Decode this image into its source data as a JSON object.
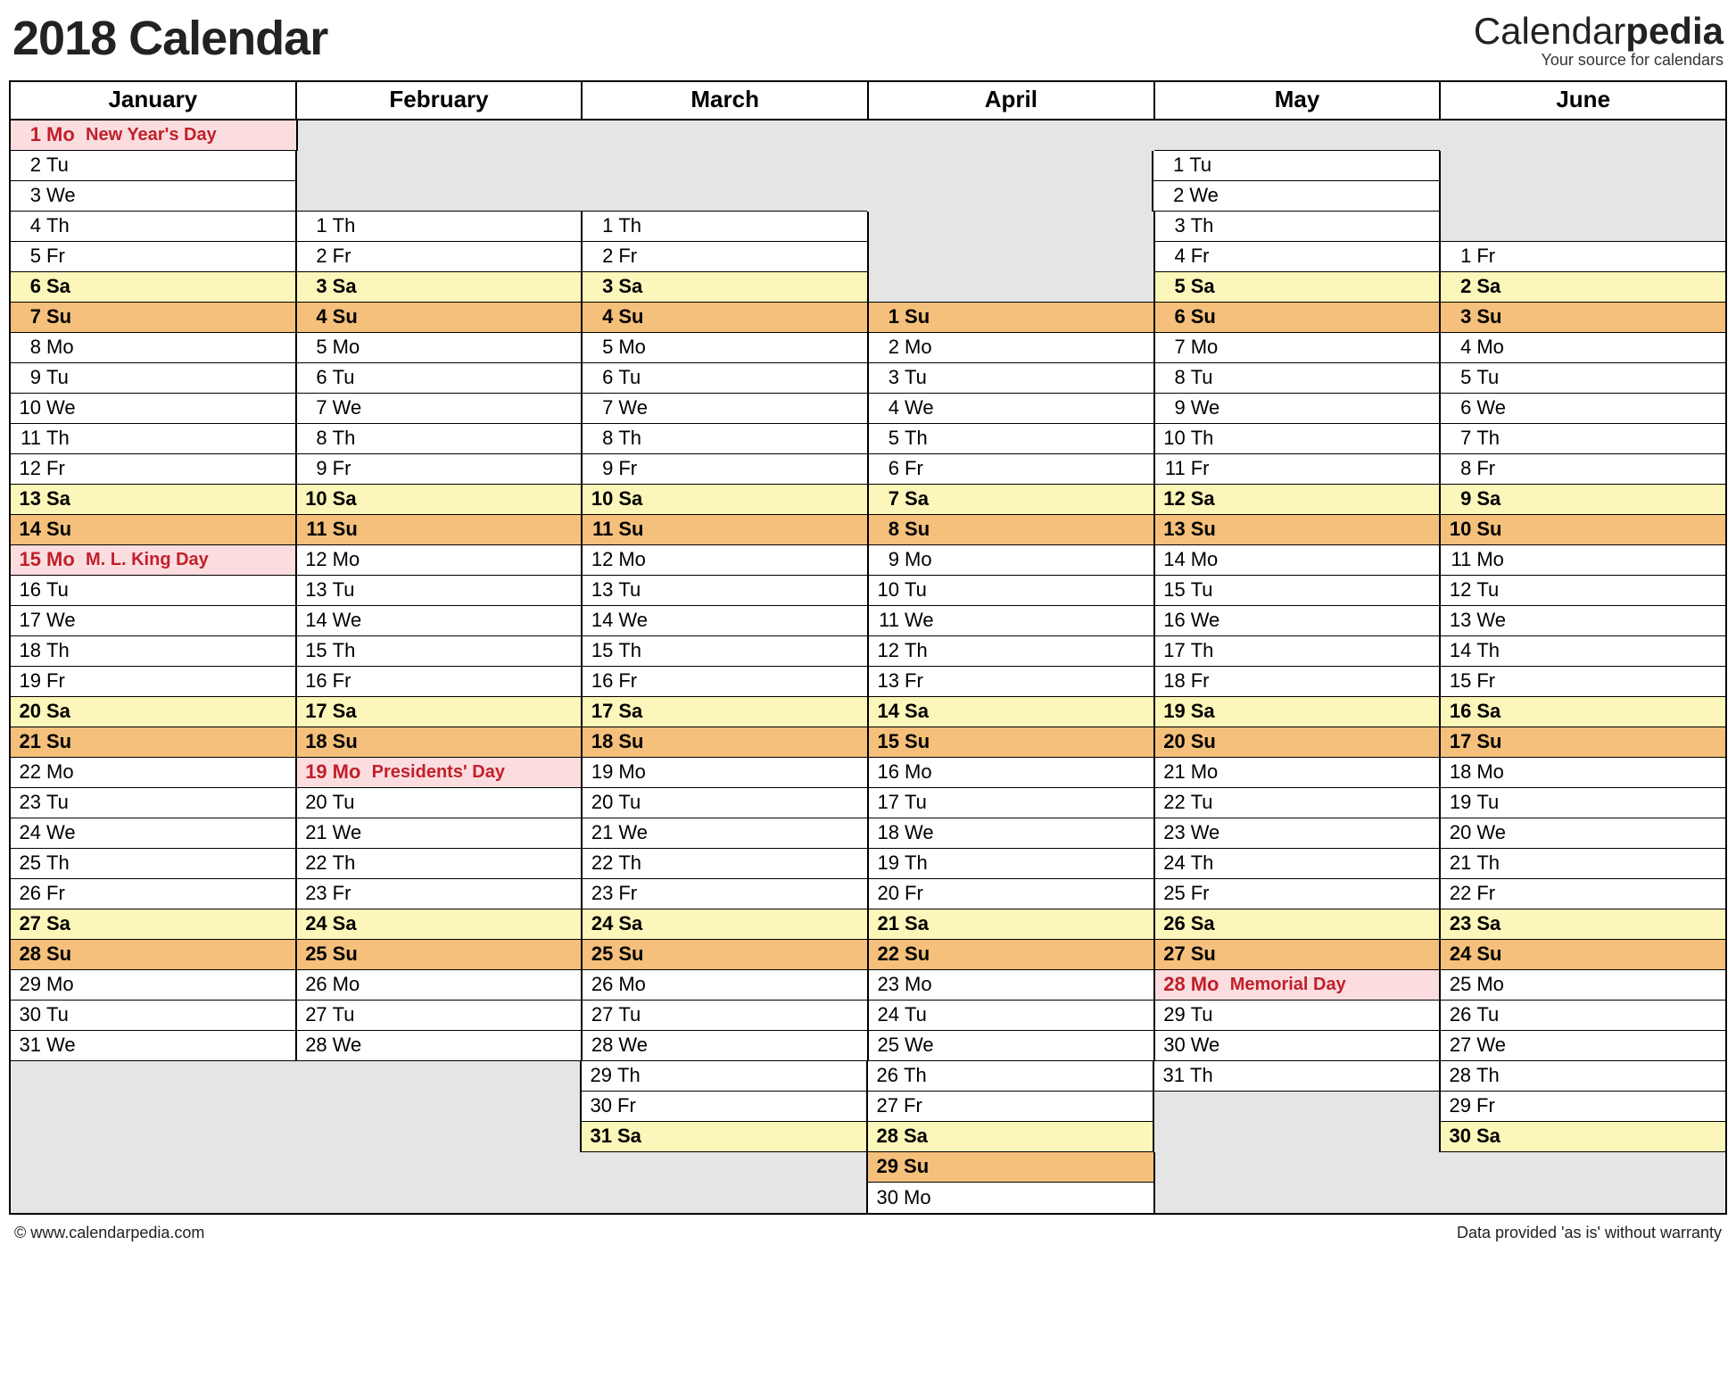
{
  "header": {
    "title": "2018 Calendar",
    "brand_main_a": "Calendar",
    "brand_main_b": "pedia",
    "brand_sub": "Your source for calendars"
  },
  "footer": {
    "left": "© www.calendarpedia.com",
    "right": "Data provided 'as is' without warranty"
  },
  "months": [
    "January",
    "February",
    "March",
    "April",
    "May",
    "June"
  ],
  "rows": [
    [
      {
        "n": 1,
        "d": "Mo",
        "e": "New Year's Day",
        "h": true
      },
      null,
      null,
      null,
      null,
      null
    ],
    [
      {
        "n": 2,
        "d": "Tu"
      },
      null,
      null,
      null,
      {
        "n": 1,
        "d": "Tu"
      },
      null
    ],
    [
      {
        "n": 3,
        "d": "We"
      },
      null,
      null,
      null,
      {
        "n": 2,
        "d": "We"
      },
      null
    ],
    [
      {
        "n": 4,
        "d": "Th"
      },
      {
        "n": 1,
        "d": "Th"
      },
      {
        "n": 1,
        "d": "Th"
      },
      null,
      {
        "n": 3,
        "d": "Th"
      },
      null
    ],
    [
      {
        "n": 5,
        "d": "Fr"
      },
      {
        "n": 2,
        "d": "Fr"
      },
      {
        "n": 2,
        "d": "Fr"
      },
      null,
      {
        "n": 4,
        "d": "Fr"
      },
      {
        "n": 1,
        "d": "Fr"
      }
    ],
    [
      {
        "n": 6,
        "d": "Sa"
      },
      {
        "n": 3,
        "d": "Sa"
      },
      {
        "n": 3,
        "d": "Sa"
      },
      null,
      {
        "n": 5,
        "d": "Sa"
      },
      {
        "n": 2,
        "d": "Sa"
      }
    ],
    [
      {
        "n": 7,
        "d": "Su"
      },
      {
        "n": 4,
        "d": "Su"
      },
      {
        "n": 4,
        "d": "Su"
      },
      {
        "n": 1,
        "d": "Su"
      },
      {
        "n": 6,
        "d": "Su"
      },
      {
        "n": 3,
        "d": "Su"
      }
    ],
    [
      {
        "n": 8,
        "d": "Mo"
      },
      {
        "n": 5,
        "d": "Mo"
      },
      {
        "n": 5,
        "d": "Mo"
      },
      {
        "n": 2,
        "d": "Mo"
      },
      {
        "n": 7,
        "d": "Mo"
      },
      {
        "n": 4,
        "d": "Mo"
      }
    ],
    [
      {
        "n": 9,
        "d": "Tu"
      },
      {
        "n": 6,
        "d": "Tu"
      },
      {
        "n": 6,
        "d": "Tu"
      },
      {
        "n": 3,
        "d": "Tu"
      },
      {
        "n": 8,
        "d": "Tu"
      },
      {
        "n": 5,
        "d": "Tu"
      }
    ],
    [
      {
        "n": 10,
        "d": "We"
      },
      {
        "n": 7,
        "d": "We"
      },
      {
        "n": 7,
        "d": "We"
      },
      {
        "n": 4,
        "d": "We"
      },
      {
        "n": 9,
        "d": "We"
      },
      {
        "n": 6,
        "d": "We"
      }
    ],
    [
      {
        "n": 11,
        "d": "Th"
      },
      {
        "n": 8,
        "d": "Th"
      },
      {
        "n": 8,
        "d": "Th"
      },
      {
        "n": 5,
        "d": "Th"
      },
      {
        "n": 10,
        "d": "Th"
      },
      {
        "n": 7,
        "d": "Th"
      }
    ],
    [
      {
        "n": 12,
        "d": "Fr"
      },
      {
        "n": 9,
        "d": "Fr"
      },
      {
        "n": 9,
        "d": "Fr"
      },
      {
        "n": 6,
        "d": "Fr"
      },
      {
        "n": 11,
        "d": "Fr"
      },
      {
        "n": 8,
        "d": "Fr"
      }
    ],
    [
      {
        "n": 13,
        "d": "Sa"
      },
      {
        "n": 10,
        "d": "Sa"
      },
      {
        "n": 10,
        "d": "Sa"
      },
      {
        "n": 7,
        "d": "Sa"
      },
      {
        "n": 12,
        "d": "Sa"
      },
      {
        "n": 9,
        "d": "Sa"
      }
    ],
    [
      {
        "n": 14,
        "d": "Su"
      },
      {
        "n": 11,
        "d": "Su"
      },
      {
        "n": 11,
        "d": "Su"
      },
      {
        "n": 8,
        "d": "Su"
      },
      {
        "n": 13,
        "d": "Su"
      },
      {
        "n": 10,
        "d": "Su"
      }
    ],
    [
      {
        "n": 15,
        "d": "Mo",
        "e": "M. L. King Day",
        "h": true
      },
      {
        "n": 12,
        "d": "Mo"
      },
      {
        "n": 12,
        "d": "Mo"
      },
      {
        "n": 9,
        "d": "Mo"
      },
      {
        "n": 14,
        "d": "Mo"
      },
      {
        "n": 11,
        "d": "Mo"
      }
    ],
    [
      {
        "n": 16,
        "d": "Tu"
      },
      {
        "n": 13,
        "d": "Tu"
      },
      {
        "n": 13,
        "d": "Tu"
      },
      {
        "n": 10,
        "d": "Tu"
      },
      {
        "n": 15,
        "d": "Tu"
      },
      {
        "n": 12,
        "d": "Tu"
      }
    ],
    [
      {
        "n": 17,
        "d": "We"
      },
      {
        "n": 14,
        "d": "We"
      },
      {
        "n": 14,
        "d": "We"
      },
      {
        "n": 11,
        "d": "We"
      },
      {
        "n": 16,
        "d": "We"
      },
      {
        "n": 13,
        "d": "We"
      }
    ],
    [
      {
        "n": 18,
        "d": "Th"
      },
      {
        "n": 15,
        "d": "Th"
      },
      {
        "n": 15,
        "d": "Th"
      },
      {
        "n": 12,
        "d": "Th"
      },
      {
        "n": 17,
        "d": "Th"
      },
      {
        "n": 14,
        "d": "Th"
      }
    ],
    [
      {
        "n": 19,
        "d": "Fr"
      },
      {
        "n": 16,
        "d": "Fr"
      },
      {
        "n": 16,
        "d": "Fr"
      },
      {
        "n": 13,
        "d": "Fr"
      },
      {
        "n": 18,
        "d": "Fr"
      },
      {
        "n": 15,
        "d": "Fr"
      }
    ],
    [
      {
        "n": 20,
        "d": "Sa"
      },
      {
        "n": 17,
        "d": "Sa"
      },
      {
        "n": 17,
        "d": "Sa"
      },
      {
        "n": 14,
        "d": "Sa"
      },
      {
        "n": 19,
        "d": "Sa"
      },
      {
        "n": 16,
        "d": "Sa"
      }
    ],
    [
      {
        "n": 21,
        "d": "Su"
      },
      {
        "n": 18,
        "d": "Su"
      },
      {
        "n": 18,
        "d": "Su"
      },
      {
        "n": 15,
        "d": "Su"
      },
      {
        "n": 20,
        "d": "Su"
      },
      {
        "n": 17,
        "d": "Su"
      }
    ],
    [
      {
        "n": 22,
        "d": "Mo"
      },
      {
        "n": 19,
        "d": "Mo",
        "e": "Presidents' Day",
        "h": true
      },
      {
        "n": 19,
        "d": "Mo"
      },
      {
        "n": 16,
        "d": "Mo"
      },
      {
        "n": 21,
        "d": "Mo"
      },
      {
        "n": 18,
        "d": "Mo"
      }
    ],
    [
      {
        "n": 23,
        "d": "Tu"
      },
      {
        "n": 20,
        "d": "Tu"
      },
      {
        "n": 20,
        "d": "Tu"
      },
      {
        "n": 17,
        "d": "Tu"
      },
      {
        "n": 22,
        "d": "Tu"
      },
      {
        "n": 19,
        "d": "Tu"
      }
    ],
    [
      {
        "n": 24,
        "d": "We"
      },
      {
        "n": 21,
        "d": "We"
      },
      {
        "n": 21,
        "d": "We"
      },
      {
        "n": 18,
        "d": "We"
      },
      {
        "n": 23,
        "d": "We"
      },
      {
        "n": 20,
        "d": "We"
      }
    ],
    [
      {
        "n": 25,
        "d": "Th"
      },
      {
        "n": 22,
        "d": "Th"
      },
      {
        "n": 22,
        "d": "Th"
      },
      {
        "n": 19,
        "d": "Th"
      },
      {
        "n": 24,
        "d": "Th"
      },
      {
        "n": 21,
        "d": "Th"
      }
    ],
    [
      {
        "n": 26,
        "d": "Fr"
      },
      {
        "n": 23,
        "d": "Fr"
      },
      {
        "n": 23,
        "d": "Fr"
      },
      {
        "n": 20,
        "d": "Fr"
      },
      {
        "n": 25,
        "d": "Fr"
      },
      {
        "n": 22,
        "d": "Fr"
      }
    ],
    [
      {
        "n": 27,
        "d": "Sa"
      },
      {
        "n": 24,
        "d": "Sa"
      },
      {
        "n": 24,
        "d": "Sa"
      },
      {
        "n": 21,
        "d": "Sa"
      },
      {
        "n": 26,
        "d": "Sa"
      },
      {
        "n": 23,
        "d": "Sa"
      }
    ],
    [
      {
        "n": 28,
        "d": "Su"
      },
      {
        "n": 25,
        "d": "Su"
      },
      {
        "n": 25,
        "d": "Su"
      },
      {
        "n": 22,
        "d": "Su"
      },
      {
        "n": 27,
        "d": "Su"
      },
      {
        "n": 24,
        "d": "Su"
      }
    ],
    [
      {
        "n": 29,
        "d": "Mo"
      },
      {
        "n": 26,
        "d": "Mo"
      },
      {
        "n": 26,
        "d": "Mo"
      },
      {
        "n": 23,
        "d": "Mo"
      },
      {
        "n": 28,
        "d": "Mo",
        "e": "Memorial Day",
        "h": true
      },
      {
        "n": 25,
        "d": "Mo"
      }
    ],
    [
      {
        "n": 30,
        "d": "Tu"
      },
      {
        "n": 27,
        "d": "Tu"
      },
      {
        "n": 27,
        "d": "Tu"
      },
      {
        "n": 24,
        "d": "Tu"
      },
      {
        "n": 29,
        "d": "Tu"
      },
      {
        "n": 26,
        "d": "Tu"
      }
    ],
    [
      {
        "n": 31,
        "d": "We"
      },
      {
        "n": 28,
        "d": "We"
      },
      {
        "n": 28,
        "d": "We"
      },
      {
        "n": 25,
        "d": "We"
      },
      {
        "n": 30,
        "d": "We"
      },
      {
        "n": 27,
        "d": "We"
      }
    ],
    [
      null,
      null,
      {
        "n": 29,
        "d": "Th"
      },
      {
        "n": 26,
        "d": "Th"
      },
      {
        "n": 31,
        "d": "Th"
      },
      {
        "n": 28,
        "d": "Th"
      }
    ],
    [
      null,
      null,
      {
        "n": 30,
        "d": "Fr"
      },
      {
        "n": 27,
        "d": "Fr"
      },
      null,
      {
        "n": 29,
        "d": "Fr"
      }
    ],
    [
      null,
      null,
      {
        "n": 31,
        "d": "Sa"
      },
      {
        "n": 28,
        "d": "Sa"
      },
      null,
      {
        "n": 30,
        "d": "Sa"
      }
    ],
    [
      null,
      null,
      null,
      {
        "n": 29,
        "d": "Su"
      },
      null,
      null
    ],
    [
      null,
      null,
      null,
      {
        "n": 30,
        "d": "Mo"
      },
      null,
      null
    ]
  ]
}
